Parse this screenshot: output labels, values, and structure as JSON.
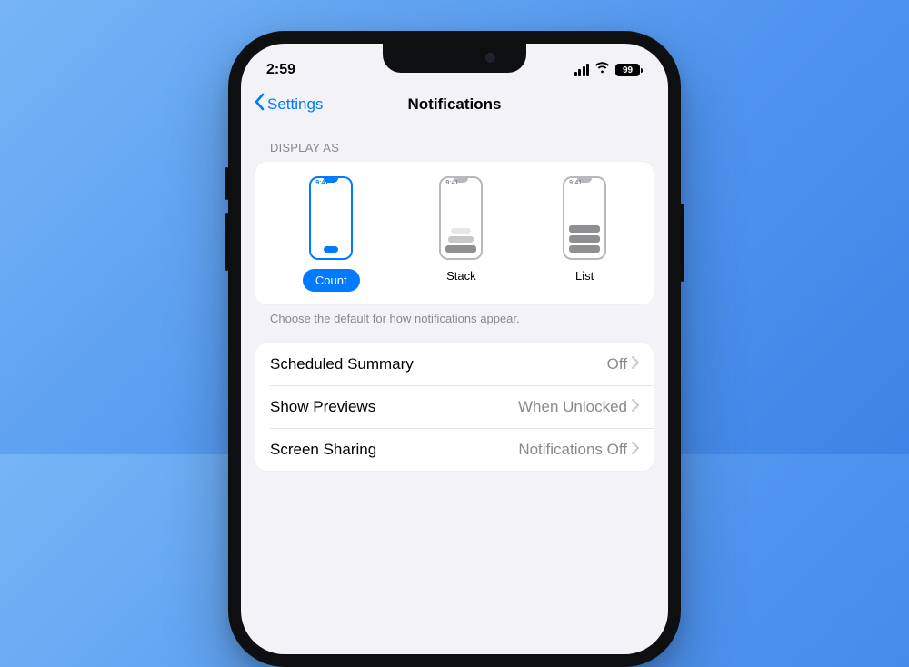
{
  "status": {
    "time": "2:59",
    "battery": "99"
  },
  "nav": {
    "back": "Settings",
    "title": "Notifications"
  },
  "display_as": {
    "header": "DISPLAY AS",
    "mini_time": "9:41",
    "options": [
      {
        "label": "Count",
        "selected": true
      },
      {
        "label": "Stack",
        "selected": false
      },
      {
        "label": "List",
        "selected": false
      }
    ],
    "footer": "Choose the default for how notifications appear."
  },
  "rows": [
    {
      "label": "Scheduled Summary",
      "value": "Off"
    },
    {
      "label": "Show Previews",
      "value": "When Unlocked"
    },
    {
      "label": "Screen Sharing",
      "value": "Notifications Off"
    }
  ]
}
